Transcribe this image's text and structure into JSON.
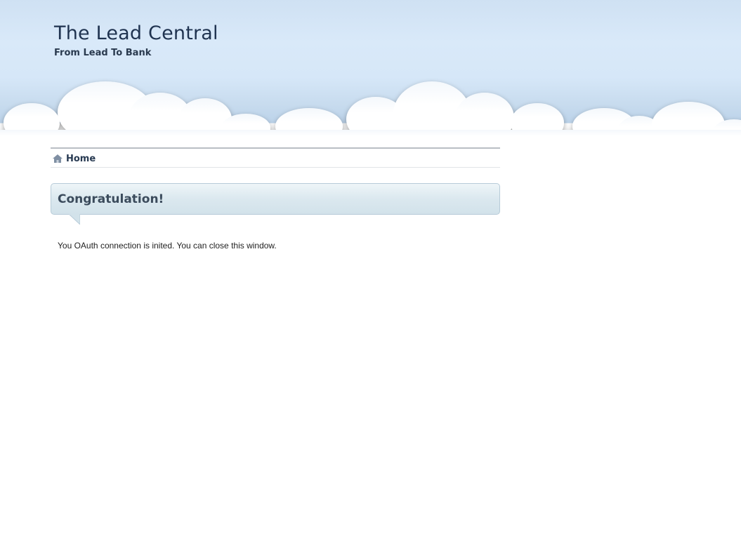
{
  "header": {
    "title": "The Lead Central",
    "tagline": "From Lead To Bank"
  },
  "nav": {
    "home": {
      "icon": "home-icon",
      "label": "Home"
    }
  },
  "message": {
    "title": "Congratulation!",
    "body": "You OAuth connection is inited. You can close this window."
  },
  "colors": {
    "sky": "#d9e9f9",
    "title_text": "#1f3350",
    "box_border": "#b7cbd8"
  }
}
